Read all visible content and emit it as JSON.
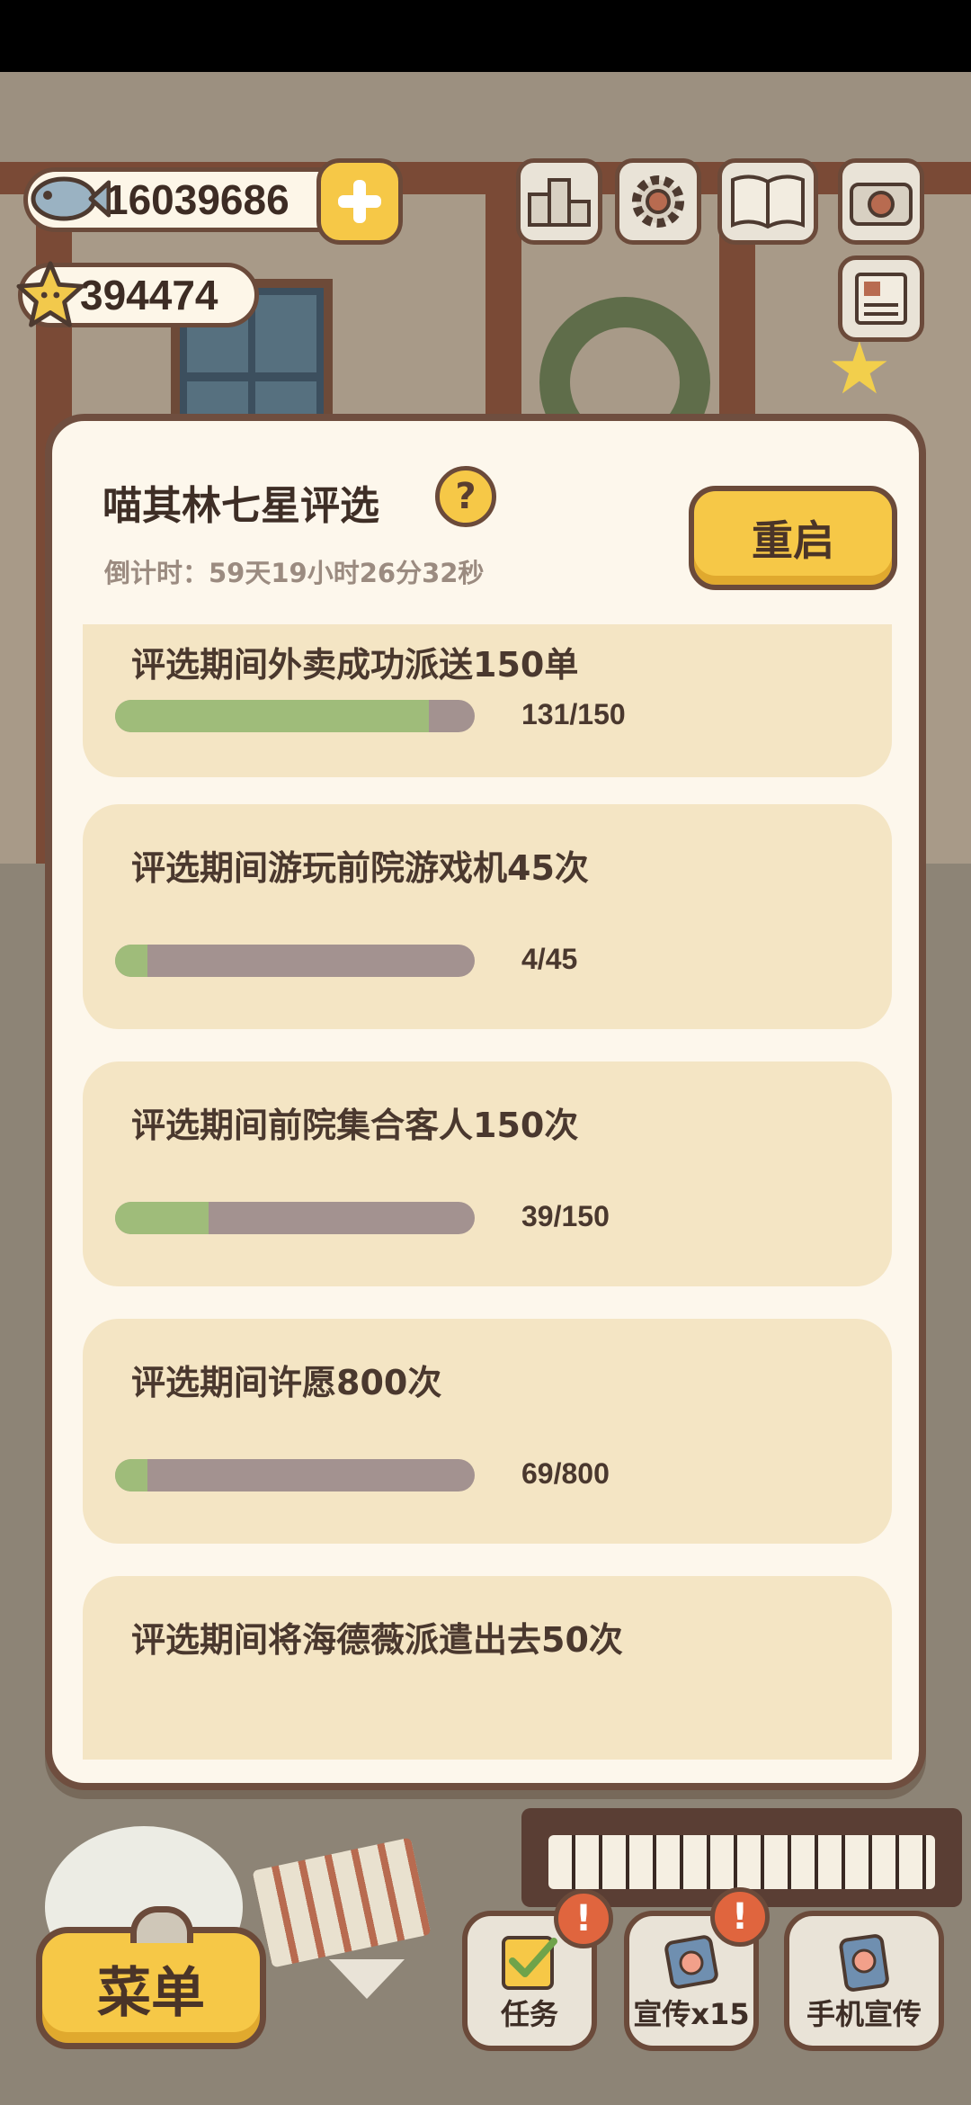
{
  "hud": {
    "fish_count": "16039686",
    "star_count": "394474"
  },
  "panel": {
    "title": "喵其林七星评选",
    "countdown": "倒计时：59天19小时26分32秒",
    "restart_label": "重启",
    "help_symbol": "?"
  },
  "tasks": [
    {
      "title": "评选期间外卖成功派送150单",
      "current": 131,
      "target": 150,
      "progress_text": "131/150"
    },
    {
      "title": "评选期间游玩前院游戏机45次",
      "current": 4,
      "target": 45,
      "progress_text": "4/45"
    },
    {
      "title": "评选期间前院集合客人150次",
      "current": 39,
      "target": 150,
      "progress_text": "39/150"
    },
    {
      "title": "评选期间许愿800次",
      "current": 69,
      "target": 800,
      "progress_text": "69/800"
    },
    {
      "title": "评选期间将海德薇派遣出去50次"
    }
  ],
  "bottom_bar": {
    "menu_label": "菜单",
    "tasks_label": "任务",
    "promo_label": "宣传x15",
    "phone_promo_label": "手机宣传",
    "alert_symbol": "!"
  },
  "colors": {
    "accent_yellow": "#f6c847",
    "progress_fill": "#9fbc7a",
    "progress_track": "#a39290",
    "card_bg": "#f4e5c4",
    "panel_bg": "#fdf7ec",
    "border_brown": "#6f4e3f",
    "alert_red": "#e0653e"
  },
  "icons": [
    "fish-icon",
    "star-icon",
    "plus-icon",
    "leaderboard-icon",
    "settings-gear-icon",
    "album-book-icon",
    "camera-icon",
    "newspaper-icon",
    "help-icon",
    "task-checklist-icon",
    "promo-card-icon",
    "phone-icon",
    "alert-icon",
    "chevron-down-icon"
  ]
}
